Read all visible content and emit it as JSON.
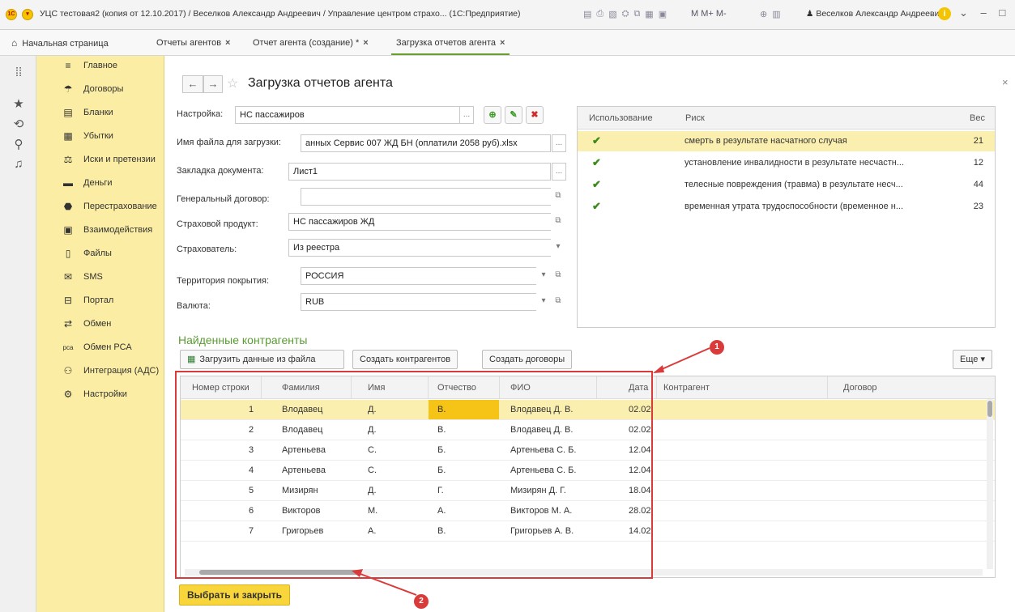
{
  "window": {
    "logo": "1С",
    "title": "УЦС тестовая2 (копия от 12.10.2017) / Веселков Александр Андреевич / Управление центром страхо... (1С:Предприятие)",
    "m_buttons": "M  M+  M-",
    "user": "Веселков Александр Андреевич",
    "info": "i",
    "controls": "⌄ – □ ✕"
  },
  "tabs": [
    {
      "label": "Начальная страница"
    },
    {
      "label": "Отчеты агентов"
    },
    {
      "label": "Отчет агента (создание) *"
    },
    {
      "label": "Загрузка отчетов агента"
    }
  ],
  "tab_close": "×",
  "sidebar": {
    "items": [
      {
        "label": "Главное",
        "icon": "≡"
      },
      {
        "label": "Договоры",
        "icon": "☂"
      },
      {
        "label": "Бланки",
        "icon": "▤"
      },
      {
        "label": "Убытки",
        "icon": "▦"
      },
      {
        "label": "Иски и претензии",
        "icon": "⚖"
      },
      {
        "label": "Деньги",
        "icon": "▬"
      },
      {
        "label": "Перестрахование",
        "icon": "⬣"
      },
      {
        "label": "Взаимодействия",
        "icon": "▣"
      },
      {
        "label": "Файлы",
        "icon": "▯"
      },
      {
        "label": "SMS",
        "icon": "✉"
      },
      {
        "label": "Портал",
        "icon": "⊟"
      },
      {
        "label": "Обмен",
        "icon": "⇄"
      },
      {
        "label": "Обмен РСА",
        "icon": "рса"
      },
      {
        "label": "Интеграция (АДС)",
        "icon": "⚇"
      },
      {
        "label": "Настройки",
        "icon": "⚙"
      }
    ]
  },
  "page": {
    "title": "Загрузка отчетов агента",
    "back": "←",
    "forward": "→",
    "star": "☆",
    "close": "×"
  },
  "form": {
    "setting_label": "Настройка:",
    "setting_value": "НС пассажиров",
    "file_label": "Имя файла для загрузки:",
    "file_value": "анных Сервис 007 ЖД БН (оплатили 2058 руб).xlsx",
    "sheet_label": "Закладка документа:",
    "sheet_value": "Лист1",
    "contract_label": "Генеральный договор:",
    "contract_value": "",
    "product_label": "Страховой продукт:",
    "product_value": "НС пассажиров ЖД",
    "insurer_label": "Страхователь:",
    "insurer_value": "Из реестра",
    "territory_label": "Территория покрытия:",
    "territory_value": "РОССИЯ",
    "currency_label": "Валюта:",
    "currency_value": "RUB",
    "ellipsis": "...",
    "dropdown": "▾",
    "open": "⧉",
    "add_icon": "⊕",
    "edit_icon": "✎",
    "delete_icon": "✖"
  },
  "risks": {
    "headers": [
      "Использование",
      "Риск",
      "Вес"
    ],
    "check": "✔",
    "rows": [
      {
        "risk": "смерть в результате насчатного случая",
        "weight": "21"
      },
      {
        "risk": "установление инвалидности в результате несчастн...",
        "weight": "12"
      },
      {
        "risk": "телесные повреждения (травма) в результате несч...",
        "weight": "44"
      },
      {
        "risk": "временная утрата трудоспособности (временное н...",
        "weight": "23"
      }
    ]
  },
  "section": {
    "title": "Найденные контрагенты",
    "load_button": "Загрузить данные из файла",
    "create_contractors": "Создать контрагентов",
    "create_contracts": "Создать договоры",
    "more": "Еще ▾"
  },
  "table": {
    "headers": [
      "Номер строки",
      "Фамилия",
      "Имя",
      "Отчество",
      "ФИО",
      "Дата",
      "Контрагент",
      "Договор"
    ],
    "rows": [
      {
        "n": "1",
        "last": "Влодавец",
        "first": "Д.",
        "middle": "В.",
        "fio": "Влодавец Д. В.",
        "date": "02.02"
      },
      {
        "n": "2",
        "last": "Влодавец",
        "first": "Д.",
        "middle": "В.",
        "fio": "Влодавец Д. В.",
        "date": "02.02"
      },
      {
        "n": "3",
        "last": "Артеньева",
        "first": "С.",
        "middle": "Б.",
        "fio": "Артеньева С. Б.",
        "date": "12.04"
      },
      {
        "n": "4",
        "last": "Артеньева",
        "first": "С.",
        "middle": "Б.",
        "fio": "Артеньева С. Б.",
        "date": "12.04"
      },
      {
        "n": "5",
        "last": "Мизирян",
        "first": "Д.",
        "middle": "Г.",
        "fio": "Мизирян Д. Г.",
        "date": "18.04"
      },
      {
        "n": "6",
        "last": "Викторов",
        "first": "М.",
        "middle": "А.",
        "fio": "Викторов М. А.",
        "date": "28.02"
      },
      {
        "n": "7",
        "last": "Григорьев",
        "first": "А.",
        "middle": "В.",
        "fio": "Григорьев А. В.",
        "date": "14.02"
      }
    ]
  },
  "footer": {
    "select_close": "Выбрать и закрыть"
  },
  "annotations": {
    "badge1": "1",
    "badge2": "2"
  },
  "colors": {
    "accent_green": "#5a9c32",
    "sidebar": "#fbeda3",
    "selected_row": "#fbefb0",
    "primary_button": "#f8d63b",
    "annotation_red": "#d93b3b"
  }
}
